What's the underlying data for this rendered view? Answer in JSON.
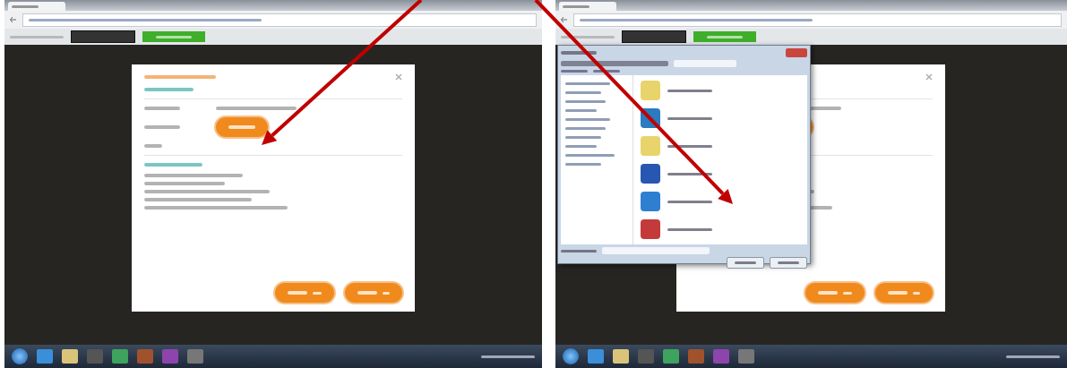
{
  "screens": [
    {
      "file_dialog_open": false,
      "pointer_arrow": true
    },
    {
      "file_dialog_open": true,
      "pointer_arrow": true
    }
  ]
}
